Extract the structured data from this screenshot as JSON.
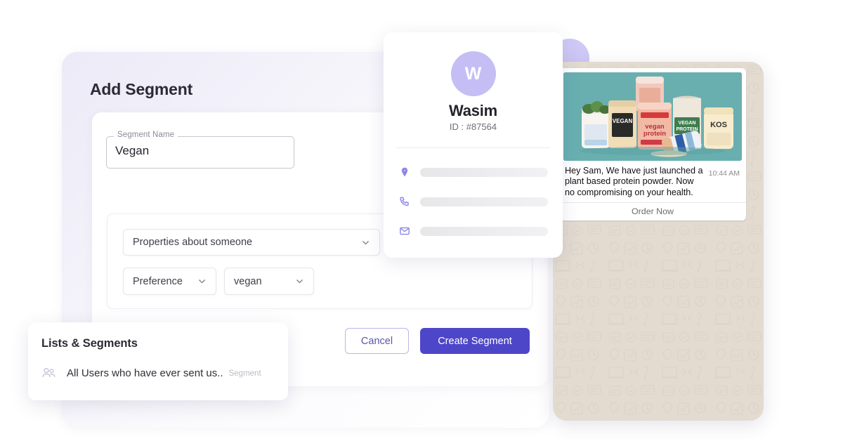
{
  "app": {
    "title": "Add Segment"
  },
  "form": {
    "segment_name": {
      "label": "Segment Name",
      "value": "Vegan",
      "placeholder": "Segment Name"
    },
    "rule": {
      "scope_select": {
        "value": "Properties about someone",
        "icon": "chevron-down-icon"
      },
      "property_select": {
        "value": "Preference",
        "icon": "chevron-down-icon"
      },
      "value_select": {
        "value": "vegan",
        "icon": "chevron-down-icon"
      }
    }
  },
  "footer": {
    "cancel_label": "Cancel",
    "create_label": "Create Segment"
  },
  "profile": {
    "avatar_initial": "W",
    "name": "Wasim",
    "id_label": "ID : #87564",
    "contacts": [
      {
        "icon": "location-pin-icon",
        "value": ""
      },
      {
        "icon": "phone-icon",
        "value": ""
      },
      {
        "icon": "email-icon",
        "value": ""
      }
    ]
  },
  "phone": {
    "message": {
      "image_alt": "plant based protein powder products",
      "body": "Hey Sam, We have just launched a plant based protein powder. Now no compromising on your health.",
      "time": "10:44 AM",
      "action_label": "Order Now"
    }
  },
  "lists_panel": {
    "title": "Lists & Segments",
    "row": {
      "icon": "people-icon",
      "label": "All Users who have ever sent us..",
      "tag": "Segment"
    }
  },
  "colors": {
    "primary": "#4e46c8",
    "cancel_border": "#b9b6e6",
    "avatar_bg": "#c4bef5",
    "deco_circle": "#cfc9f6",
    "phone_bg": "#e3dbd0",
    "image_bg": "#69afb0"
  }
}
